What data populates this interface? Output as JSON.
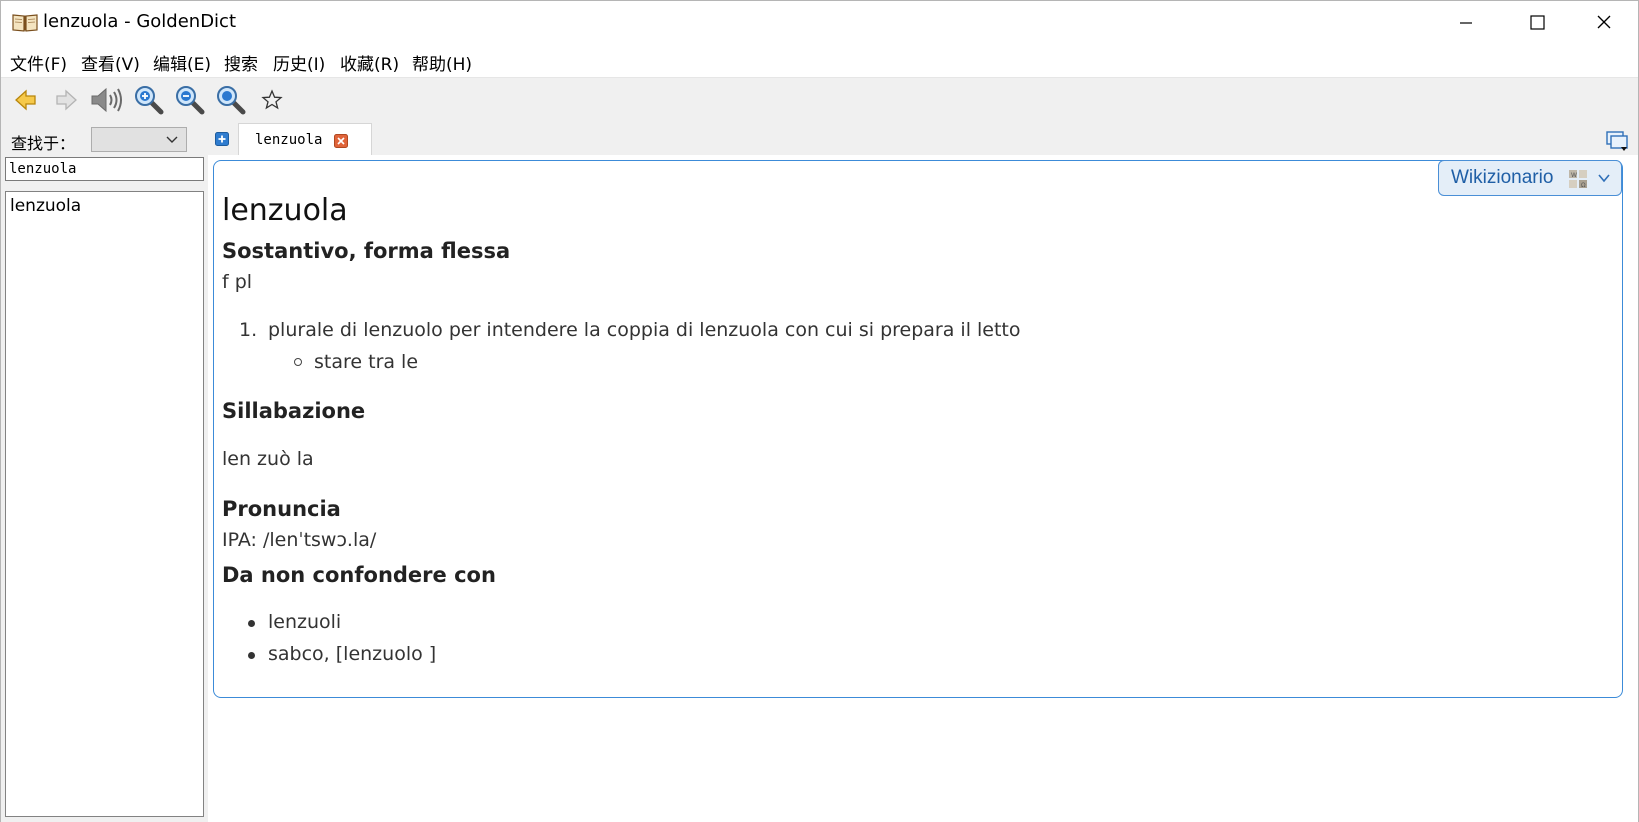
{
  "window": {
    "title": "lenzuola - GoldenDict"
  },
  "menu": {
    "items": [
      "文件(F)",
      "查看(V)",
      "编辑(E)",
      "搜索",
      "历史(I)",
      "收藏(R)",
      "帮助(H)"
    ]
  },
  "toolbar": {
    "buttons": [
      "back-arrow-icon",
      "forward-arrow-icon",
      "speaker-icon",
      "zoom-in-icon",
      "zoom-out-icon",
      "zoom-reset-icon",
      "star-icon"
    ]
  },
  "sidebar": {
    "lookin_label": "查找于：",
    "search_value": "lenzuola",
    "words": [
      "lenzuola"
    ]
  },
  "tabs": [
    {
      "label": "lenzuola",
      "active": true
    }
  ],
  "article": {
    "dictionary": "Wikizionario",
    "headword": "lenzuola",
    "pos_heading": "Sostantivo, forma flessa",
    "grammar": "f pl",
    "definitions": [
      {
        "number": "1.",
        "text": "plurale di lenzuolo per intendere la coppia di lenzuola con cui si prepara il letto",
        "examples": [
          "stare tra le"
        ]
      }
    ],
    "syllabation_heading": "Sillabazione",
    "syllabation": "len zuò la",
    "pronunciation_heading": "Pronuncia",
    "pronunciation": "IPA: /lenˈtswɔ.la/",
    "confusion_heading": "Da non confondere con",
    "confusion_items": [
      "lenzuoli",
      "sabco, [lenzuolo ]"
    ]
  },
  "colors": {
    "accent": "#3c8bd8",
    "toolbar_bg": "#f0f0f0",
    "badge_bg": "#e4eef8",
    "close_tab": "#e0643a"
  }
}
